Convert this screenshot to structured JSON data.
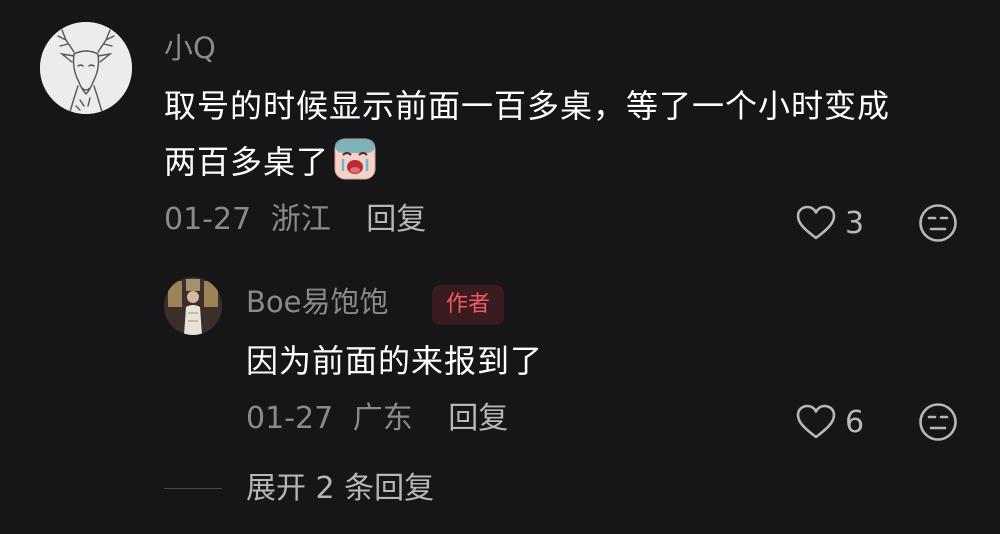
{
  "comment": {
    "username": "小Q",
    "text_line1": "取号的时候显示前面一百多桌，等了一个小时变成",
    "text_line2": "两百多桌了",
    "emoji": "crying-face-emoji",
    "date": "01-27",
    "location": "浙江",
    "reply_label": "回复",
    "like_count": "3"
  },
  "reply": {
    "username": "Boe易饱饱",
    "badge": "作者",
    "text": "因为前面的来报到了",
    "date": "01-27",
    "location": "广东",
    "reply_label": "回复",
    "like_count": "6"
  },
  "expand_label": "展开 2 条回复",
  "colors": {
    "background": "#161618",
    "text_primary": "#ffffff",
    "text_secondary": "#8a8a8e",
    "badge_text": "#f05a66",
    "badge_bg": "#3a1b1f"
  }
}
